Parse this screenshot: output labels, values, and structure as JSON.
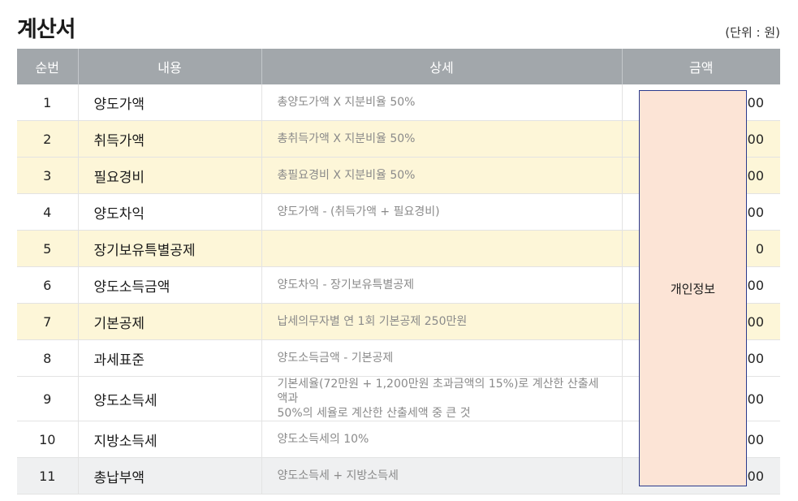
{
  "page": {
    "title": "계산서",
    "unit_note": "(단위 : 원)"
  },
  "table": {
    "headers": {
      "no": "순번",
      "item": "내용",
      "detail": "상세",
      "amount": "금액"
    },
    "rows": [
      {
        "no": "1",
        "item": "양도가액",
        "detail": "총양도가액 X 지분비율 50%",
        "amount": "00"
      },
      {
        "no": "2",
        "item": "취득가액",
        "detail": "총취득가액 X 지분비율 50%",
        "amount": "00"
      },
      {
        "no": "3",
        "item": "필요경비",
        "detail": "총필요경비 X 지분비율 50%",
        "amount": "00"
      },
      {
        "no": "4",
        "item": "양도차익",
        "detail": "양도가액 - (취득가액 + 필요경비)",
        "amount": "00"
      },
      {
        "no": "5",
        "item": "장기보유특별공제",
        "detail": "",
        "amount": "0"
      },
      {
        "no": "6",
        "item": "양도소득금액",
        "detail": "양도차익 - 장기보유특별공제",
        "amount": "00"
      },
      {
        "no": "7",
        "item": "기본공제",
        "detail": "납세의무자별 연 1회 기본공제 250만원",
        "amount": "00"
      },
      {
        "no": "8",
        "item": "과세표준",
        "detail": "양도소득금액 - 기본공제",
        "amount": "00"
      },
      {
        "no": "9",
        "item": "양도소득세",
        "detail_line1": "기본세율(72만원 + 1,200만원 초과금액의 15%)로 계산한 산출세액과",
        "detail_line2": "50%의 세율로 계산한 산출세액 중 큰 것",
        "amount": "00"
      },
      {
        "no": "10",
        "item": "지방소득세",
        "detail": "양도소득세의 10%",
        "amount": "00"
      },
      {
        "no": "11",
        "item": "총납부액",
        "detail": "양도소득세 + 지방소득세",
        "amount": "00"
      }
    ]
  },
  "redaction": {
    "label": "개인정보",
    "color": "#fce4d6"
  },
  "colors": {
    "header_bg": "#a2a7ab",
    "highlight_row": "#fdf6d8",
    "total_row": "#eff0f1"
  }
}
